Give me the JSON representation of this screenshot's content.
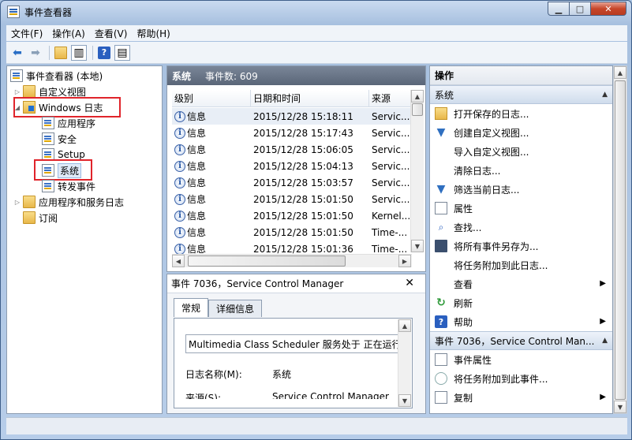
{
  "window": {
    "title": "事件查看器"
  },
  "menu": {
    "items": [
      "文件(F)",
      "操作(A)",
      "查看(V)",
      "帮助(H)"
    ]
  },
  "tree": {
    "root": "事件查看器 (本地)",
    "custom_views": "自定义视图",
    "windows_logs": "Windows 日志",
    "application": "应用程序",
    "security": "安全",
    "setup": "Setup",
    "system": "系统",
    "forwarded": "转发事件",
    "app_service_logs": "应用程序和服务日志",
    "subscriptions": "订阅"
  },
  "events": {
    "title": "系统",
    "count_label": "事件数: 609",
    "columns": [
      "级别",
      "日期和时间",
      "来源"
    ],
    "rows": [
      {
        "level": "信息",
        "datetime": "2015/12/28 15:18:11",
        "source": "Servic..."
      },
      {
        "level": "信息",
        "datetime": "2015/12/28 15:17:43",
        "source": "Servic..."
      },
      {
        "level": "信息",
        "datetime": "2015/12/28 15:06:05",
        "source": "Servic..."
      },
      {
        "level": "信息",
        "datetime": "2015/12/28 15:04:13",
        "source": "Servic..."
      },
      {
        "level": "信息",
        "datetime": "2015/12/28 15:03:57",
        "source": "Servic..."
      },
      {
        "level": "信息",
        "datetime": "2015/12/28 15:01:50",
        "source": "Servic..."
      },
      {
        "level": "信息",
        "datetime": "2015/12/28 15:01:50",
        "source": "Kernel..."
      },
      {
        "level": "信息",
        "datetime": "2015/12/28 15:01:50",
        "source": "Time-..."
      },
      {
        "level": "信息",
        "datetime": "2015/12/28 15:01:36",
        "source": "Time-..."
      }
    ]
  },
  "detail": {
    "title": "事件 7036，Service Control Manager",
    "tabs": [
      "常规",
      "详细信息"
    ],
    "description": "Multimedia Class Scheduler 服务处于 正在运行",
    "log_name_label": "日志名称(M):",
    "log_name_value": "系统",
    "source_label": "来源(S):",
    "source_value": "Service Control Manager"
  },
  "actions": {
    "header": "操作",
    "section1": "系统",
    "items1": [
      "打开保存的日志...",
      "创建自定义视图...",
      "导入自定义视图...",
      "清除日志...",
      "筛选当前日志...",
      "属性",
      "查找...",
      "将所有事件另存为...",
      "将任务附加到此日志...",
      "查看",
      "刷新",
      "帮助"
    ],
    "section2": "事件 7036，Service Control Man...",
    "items2": [
      "事件属性",
      "将任务附加到此事件...",
      "复制"
    ]
  }
}
